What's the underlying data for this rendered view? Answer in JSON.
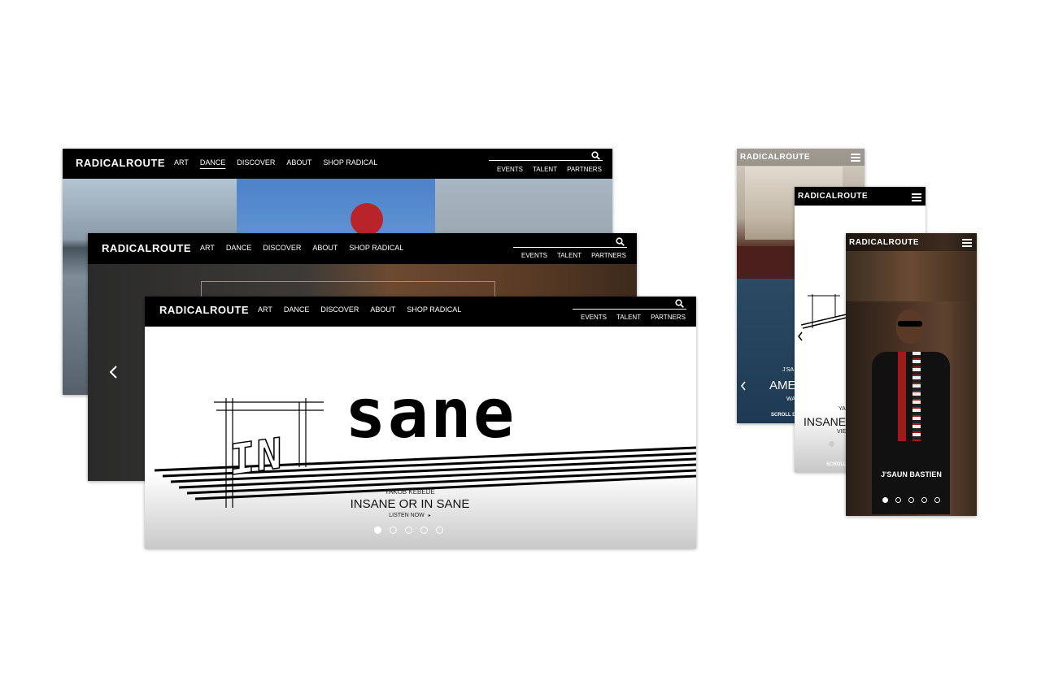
{
  "brand": "RADICALROUTE",
  "nav_items": [
    "ART",
    "DANCE",
    "DISCOVER",
    "ABOUT",
    "SHOP RADICAL"
  ],
  "sub_items": [
    "EVENTS",
    "TALENT",
    "PARTNERS"
  ],
  "hero": {
    "artwork_main": "sane",
    "artwork_in": "IN",
    "artist": "YAKOB KEBEDE",
    "title": "INSANE OR IN SANE",
    "cta": "LISTEN NOW"
  },
  "mobile_a": {
    "artist": "J'SA",
    "title": "AME",
    "sub": "WA",
    "footer": "SCROLL D"
  },
  "mobile_b": {
    "artist": "YA",
    "title": "INSANE",
    "sub": "VIE",
    "footer": "SCROLL"
  },
  "mobile_c": {
    "caption": "J'SAUN BASTIEN"
  },
  "carousel_slide_count": 5,
  "icons": [
    "search-icon",
    "menu-icon",
    "chevron-left-icon",
    "caret-right-icon"
  ],
  "colors": {
    "nav_bg": "#000000",
    "text": "#ffffff",
    "page_bg": "#ffffff"
  }
}
